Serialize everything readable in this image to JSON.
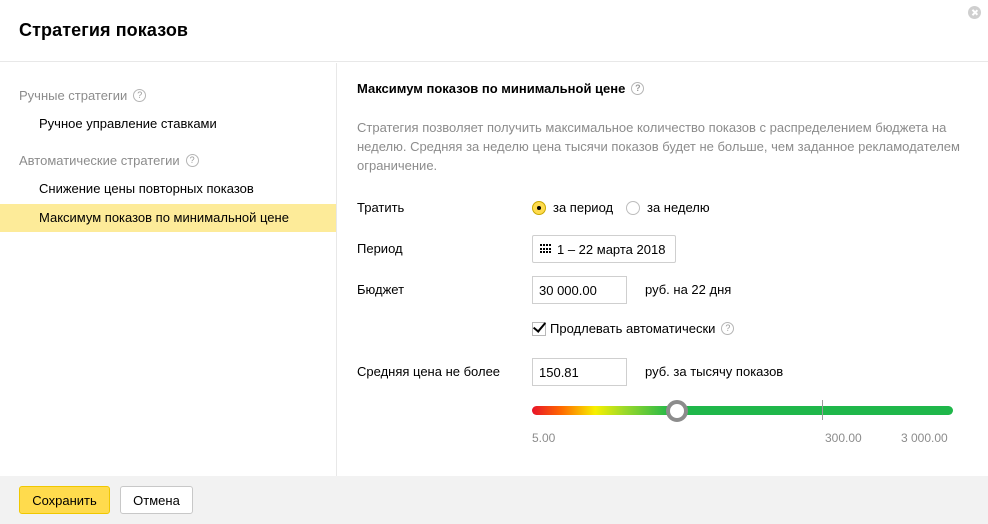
{
  "dialog": {
    "title": "Стратегия показов"
  },
  "sidebar": {
    "groups": [
      {
        "title": "Ручные стратегии",
        "items": [
          "Ручное управление ставками"
        ]
      },
      {
        "title": "Автоматические стратегии",
        "items": [
          "Снижение цены повторных показов",
          "Максимум показов по минимальной цене"
        ]
      }
    ],
    "active_item": "Максимум показов по минимальной цене"
  },
  "main": {
    "title": "Максимум показов по минимальной цене",
    "description": "Стратегия позволяет получить максимальное количество показов с распределением бюджета на неделю. Средняя за неделю цена тысячи показов будет не больше, чем заданное рекламодателем ограничение.",
    "spend": {
      "label": "Тратить",
      "options": [
        "за период",
        "за неделю"
      ],
      "selected": "за период"
    },
    "period": {
      "label": "Период",
      "value": "1 – 22 марта 2018",
      "icon": "calendar-icon"
    },
    "budget": {
      "label": "Бюджет",
      "value": "30 000.00",
      "unit": "руб. на 22 дня"
    },
    "auto_extend": {
      "label": "Продлевать автоматически",
      "checked": true
    },
    "avg_price": {
      "label": "Средняя цена не более",
      "value": "150.81",
      "unit": "руб. за тысячу показов"
    },
    "slider": {
      "min_label": "5.00",
      "mark_label": "300.00",
      "max_label": "3 000.00",
      "value": 150.81
    },
    "help_icon": "?"
  },
  "footer": {
    "save_label": "Сохранить",
    "cancel_label": "Отмена"
  },
  "colors": {
    "accent": "#ffdb4d",
    "active_row": "#fdeb99",
    "slider_green": "#1fb74a",
    "slider_red": "#e8132a"
  }
}
